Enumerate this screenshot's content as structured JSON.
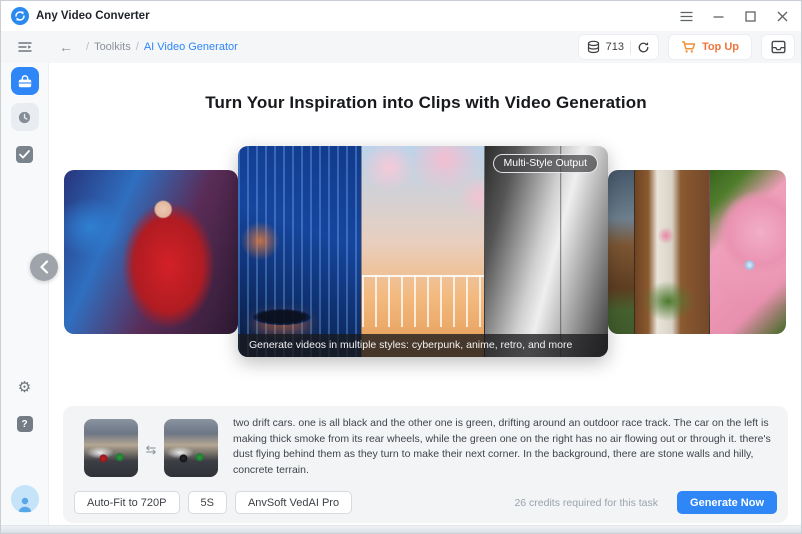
{
  "app": {
    "title": "Any Video Converter"
  },
  "nav": {
    "back_glyph": "←",
    "breadcrumb": {
      "sep1": "/",
      "toolkits": "Toolkits",
      "sep2": "/",
      "current": "AI Video Generator"
    },
    "credits": "713",
    "topup_label": "Top Up"
  },
  "hero": {
    "heading": "Turn Your Inspiration into Clips with Video Generation"
  },
  "carousel": {
    "badge": "Multi-Style Output",
    "caption": "Generate videos in multiple styles: cyberpunk, anime, retro, and more"
  },
  "task": {
    "prompt": "two drift cars. one is all black and the other one is green, drifting around an outdoor race track. The car on the left is making thick smoke from its rear wheels, while the green one on the right has no air flowing out or through it. there's dust flying behind them as they turn to make their next corner. In the background, there are stone walls and hilly, concrete terrain.",
    "swap_glyph": "⇆",
    "options": [
      {
        "label": "Auto-Fit to 720P"
      },
      {
        "label": "5S"
      },
      {
        "label": "AnvSoft VedAI Pro"
      }
    ],
    "credits_note": "26 credits required for this task",
    "generate_label": "Generate Now"
  },
  "icons": {
    "gear_glyph": "⚙",
    "help_glyph": "?"
  },
  "colors": {
    "accent_blue": "#2e86f7",
    "accent_orange": "#f0753c",
    "nav_bg": "#f4f6f8",
    "panel_bg": "#f2f4f6"
  }
}
